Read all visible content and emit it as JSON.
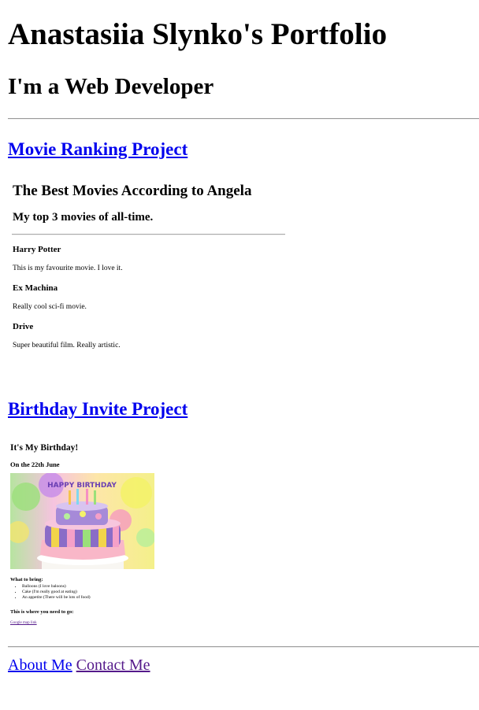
{
  "header": {
    "title": "Anastasiia Slynko's Portfolio",
    "subtitle": "I'm a Web Developer"
  },
  "projects": {
    "movie_link": "Movie Ranking Project",
    "birthday_link": "Birthday Invite Project"
  },
  "movies": {
    "title": "The Best Movies According to Angela",
    "subtitle": "My top 3 movies of all-time.",
    "items": [
      {
        "title": "Harry Potter",
        "desc": "This is my favourite movie. I love it."
      },
      {
        "title": "Ex Machina",
        "desc": "Really cool sci-fi movie."
      },
      {
        "title": "Drive",
        "desc": "Super beautiful film. Really artistic."
      }
    ]
  },
  "birthday": {
    "title": "It's My Birthday!",
    "date": "On the 22th June",
    "cake_text": "HAPPY BIRTHDAY",
    "bring_heading": "What to bring:",
    "bring_items": [
      "Balloons (I love baloons)",
      "Cake (I'm really good at eating)",
      "An appetite (There will be lots of food)"
    ],
    "where_heading": "This is where you need to go:",
    "map_link": "Google map link"
  },
  "footer": {
    "about": "About Me",
    "contact": "Contact Me"
  },
  "colors": {
    "link": "#0000ee",
    "visited_link": "#551a8b"
  }
}
